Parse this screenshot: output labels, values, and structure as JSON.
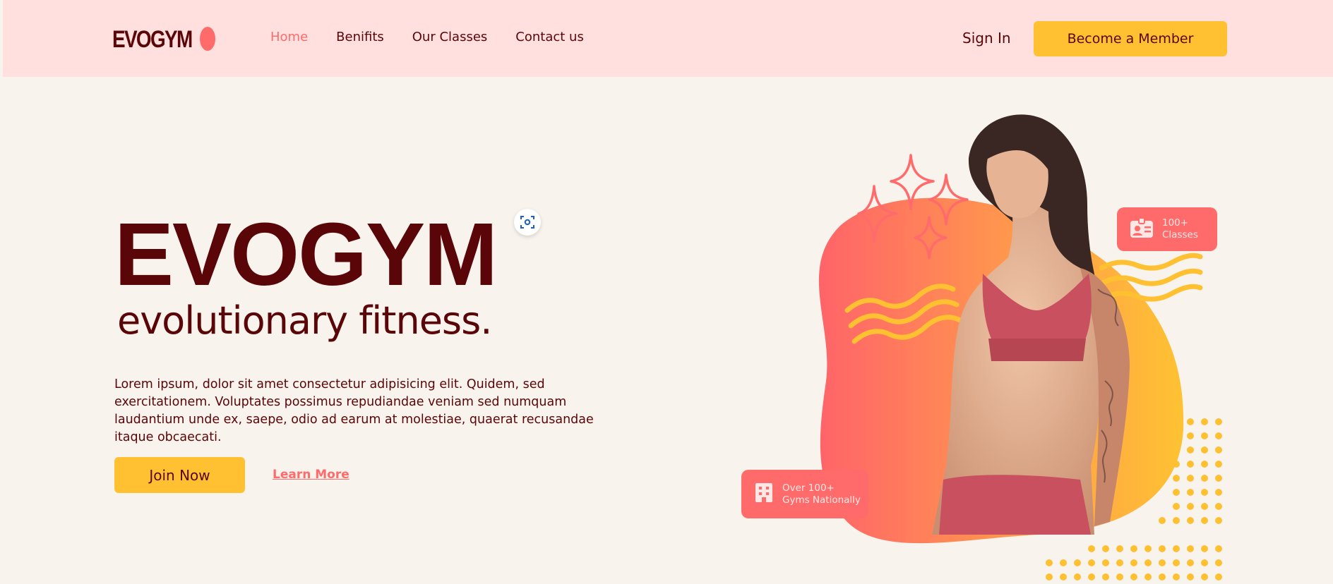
{
  "brand": {
    "name": "EVOGYM"
  },
  "nav": {
    "items": [
      {
        "label": "Home",
        "active": true
      },
      {
        "label": "Benifits",
        "active": false
      },
      {
        "label": "Our Classes",
        "active": false
      },
      {
        "label": "Contact us",
        "active": false
      }
    ],
    "sign_in": "Sign In",
    "cta": "Become a Member"
  },
  "hero": {
    "title": "EVOGYM",
    "subtitle": "evolutionary fitness.",
    "description": "Lorem ipsum, dolor sit amet consectetur adipisicing elit. Quidem, sed exercitationem. Voluptates possimus repudiandae veniam sed numquam laudantium unde ex, saepe, odio ad earum at molestiae, quaerat recusandae itaque obcaecati.",
    "join_label": "Join Now",
    "learn_label": "Learn More"
  },
  "stats": {
    "classes": {
      "line1": "100+",
      "line2": "Classes",
      "icon": "id-card-icon"
    },
    "gyms": {
      "line1": "Over 100+",
      "line2": "Gyms Nationally",
      "icon": "building-icon"
    }
  },
  "colors": {
    "primary_dark": "#5a0508",
    "accent_red": "#ff6b6b",
    "accent_yellow": "#ffc132",
    "nav_bg": "#ffe0df",
    "page_bg": "#f8f3ec"
  }
}
